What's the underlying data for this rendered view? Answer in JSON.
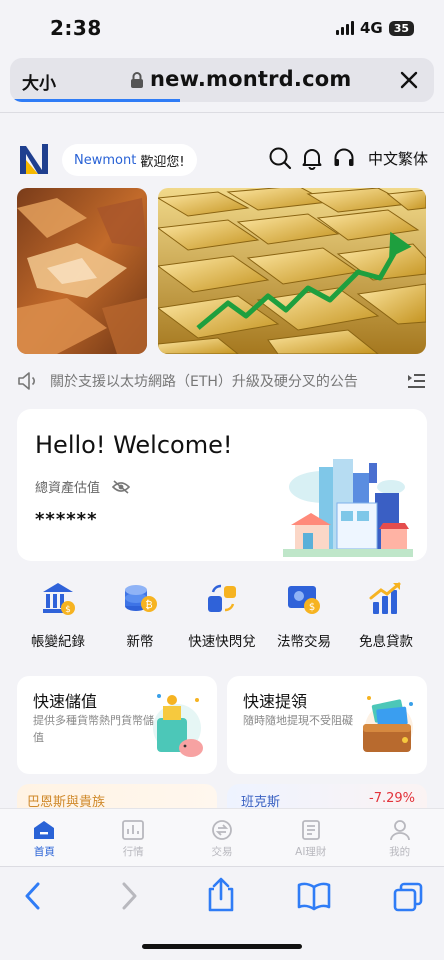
{
  "status": {
    "time": "2:38",
    "network": "4G",
    "battery": "35"
  },
  "browser": {
    "text_size_label": "大小",
    "url": "new.montrd.com",
    "load_progress": 0.4
  },
  "header": {
    "brand": "Newmont",
    "greeting": "歡迎您!",
    "language": "中文繁体"
  },
  "notice": {
    "text": "關於支援以太坊網路（ETH）升級及硬分叉的公告"
  },
  "welcome_card": {
    "title": "Hello! Welcome!",
    "assets_label": "總資產估值",
    "assets_value": "******"
  },
  "actions": [
    {
      "label": "帳變紀錄",
      "icon": "bank-icon"
    },
    {
      "label": "新幣",
      "icon": "coins-icon"
    },
    {
      "label": "快速快閃兌",
      "icon": "exchange-icon"
    },
    {
      "label": "法幣交易",
      "icon": "fiat-icon"
    },
    {
      "label": "免息貸款",
      "icon": "loan-chart-icon"
    }
  ],
  "quick_cards": [
    {
      "title": "快速儲值",
      "desc": "提供多種貨幣熱門貨幣儲值"
    },
    {
      "title": "快速提領",
      "desc": "隨時隨地提現不受阻礙"
    }
  ],
  "market_peek": [
    {
      "name": "巴恩斯與貴族",
      "change": ""
    },
    {
      "name": "班克斯",
      "change": "-7.29%"
    }
  ],
  "tabs": [
    {
      "label": "首頁",
      "active": true
    },
    {
      "label": "行情",
      "active": false
    },
    {
      "label": "交易",
      "active": false
    },
    {
      "label": "AI理財",
      "active": false
    },
    {
      "label": "我的",
      "active": false
    }
  ],
  "colors": {
    "accent": "#2a63d6",
    "negative": "#e2323a",
    "logo_yellow": "#f5b800"
  }
}
